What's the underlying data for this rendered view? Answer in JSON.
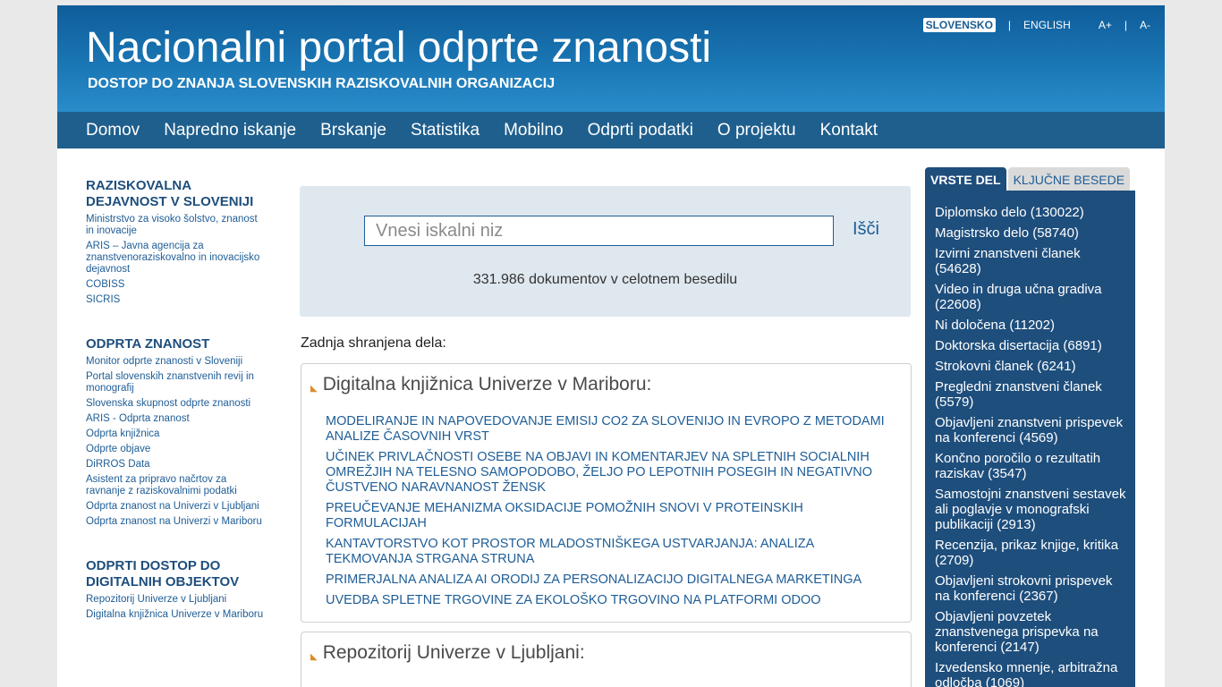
{
  "header": {
    "title": "Nacionalni portal odprte znanosti",
    "subtitle": "DOSTOP DO ZNANJA SLOVENSKIH RAZISKOVALNIH ORGANIZACIJ",
    "lang": {
      "slovensko": "SLOVENSKO",
      "english": "ENGLISH",
      "font_bigger": "A+",
      "font_smaller": "A-",
      "separator": "|"
    }
  },
  "nav": [
    "Domov",
    "Napredno iskanje",
    "Brskanje",
    "Statistika",
    "Mobilno",
    "Odprti podatki",
    "O projektu",
    "Kontakt"
  ],
  "sidebar": {
    "sections": [
      {
        "title": "RAZISKOVALNA DEJAVNOST V SLOVENIJI",
        "links": [
          "Ministrstvo za visoko šolstvo, znanost in inovacije",
          "ARIS – Javna agencija za znanstvenoraziskovalno in inovacijsko dejavnost",
          "COBISS",
          "SICRIS"
        ]
      },
      {
        "title": "ODPRTA ZNANOST",
        "links": [
          "Monitor odprte znanosti v Sloveniji",
          "Portal slovenskih znanstvenih revij in monografij",
          "Slovenska skupnost odprte znanosti",
          "ARIS - Odprta znanost",
          "Odprta knjižnica",
          "Odprte objave",
          "DiRROS Data",
          "Asistent za pripravo načrtov za ravnanje z raziskovalnimi podatki",
          "Odprta znanost na Univerzi v Ljubljani",
          "Odprta znanost na Univerzi v Mariboru"
        ]
      },
      {
        "title": "ODPRTI DOSTOP DO DIGITALNIH OBJEKTOV",
        "links": [
          "Repozitorij Univerze v Ljubljani",
          "Digitalna knjižnica Univerze v Mariboru"
        ]
      }
    ]
  },
  "search": {
    "placeholder": "Vnesi iskalni niz",
    "value": "",
    "button": "Išči",
    "count_text": "331.986 dokumentov v celotnem besedilu"
  },
  "recent": {
    "label": "Zadnja shranjena dela:",
    "repos": [
      {
        "title": "Digitalna knjižnica Univerze v Mariboru:",
        "items": [
          "MODELIRANJE IN NAPOVEDOVANJE EMISIJ CO2 ZA SLOVENIJO IN EVROPO Z METODAMI ANALIZE ČASOVNIH VRST",
          "UČINEK PRIVLAČNOSTI OSEBE NA OBJAVI IN KOMENTARJEV NA SPLETNIH SOCIALNIH OMREŽJIH NA TELESNO SAMOPODOBO, ŽELJO PO LEPOTNIH POSEGIH IN NEGATIVNO ČUSTVENO NARAVNANOST ŽENSK",
          "PREUČEVANJE MEHANIZMA OKSIDACIJE POMOŽNIH SNOVI V PROTEINSKIH FORMULACIJAH",
          "KANTAVTORSTVO KOT PROSTOR MLADOSTNIŠKEGA USTVARJANJA: ANALIZA TEKMOVANJA STRGANA STRUNA",
          "PRIMERJALNA ANALIZA AI ORODIJ ZA PERSONALIZACIJO DIGITALNEGA MARKETINGA",
          "UVEDBA SPLETNE TRGOVINE ZA EKOLOŠKO TRGOVINO NA PLATFORMI ODOO"
        ]
      },
      {
        "title": "Repozitorij Univerze v Ljubljani:",
        "items": []
      }
    ]
  },
  "right_panel": {
    "tabs": [
      "VRSTE DEL",
      "KLJUČNE BESEDE"
    ],
    "types": [
      "Diplomsko delo (130022)",
      "Magistrsko delo (58740)",
      "Izvirni znanstveni članek (54628)",
      "Video in druga učna gradiva (22608)",
      "Ni določena (11202)",
      "Doktorska disertacija (6891)",
      "Strokovni članek (6241)",
      "Pregledni znanstveni članek (5579)",
      "Objavljeni znanstveni prispevek na konferenci (4569)",
      "Končno poročilo o rezultatih raziskav (3547)",
      "Samostojni znanstveni sestavek ali poglavje v monografski publikaciji (2913)",
      "Recenzija, prikaz knjige, kritika (2709)",
      "Objavljeni strokovni prispevek na konferenci (2367)",
      "Objavljeni povzetek znanstvenega prispevka na konferenci (2147)",
      "Izvedensko mnenje, arbitražna odločba (1069)"
    ]
  },
  "colors": {
    "header_blue": "#1a76b4",
    "nav_blue": "#1f5f8d",
    "link_blue": "#1e5d96",
    "panel_navy": "#1e4e7c",
    "search_bg": "#dfe8ef"
  }
}
